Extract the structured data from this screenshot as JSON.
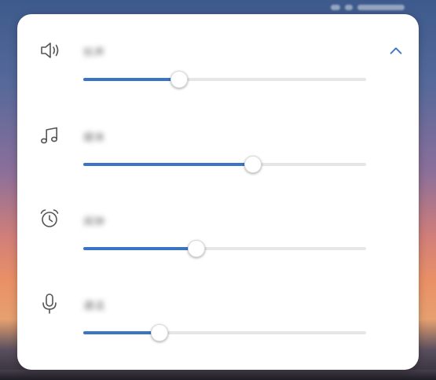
{
  "status_bar": {
    "icons": [
      "signal-icon",
      "battery-icon",
      "time-blurred"
    ]
  },
  "panel": {
    "collapse_icon": "chevron-up-icon",
    "accent_color": "#3b74c4",
    "rows": [
      {
        "icon": "speaker-icon",
        "label": "铃声",
        "level": 0.34
      },
      {
        "icon": "music-note-icon",
        "label": "媒体",
        "level": 0.6
      },
      {
        "icon": "alarm-clock-icon",
        "label": "闹钟",
        "level": 0.4
      },
      {
        "icon": "microphone-icon",
        "label": "通话",
        "level": 0.27
      }
    ]
  }
}
